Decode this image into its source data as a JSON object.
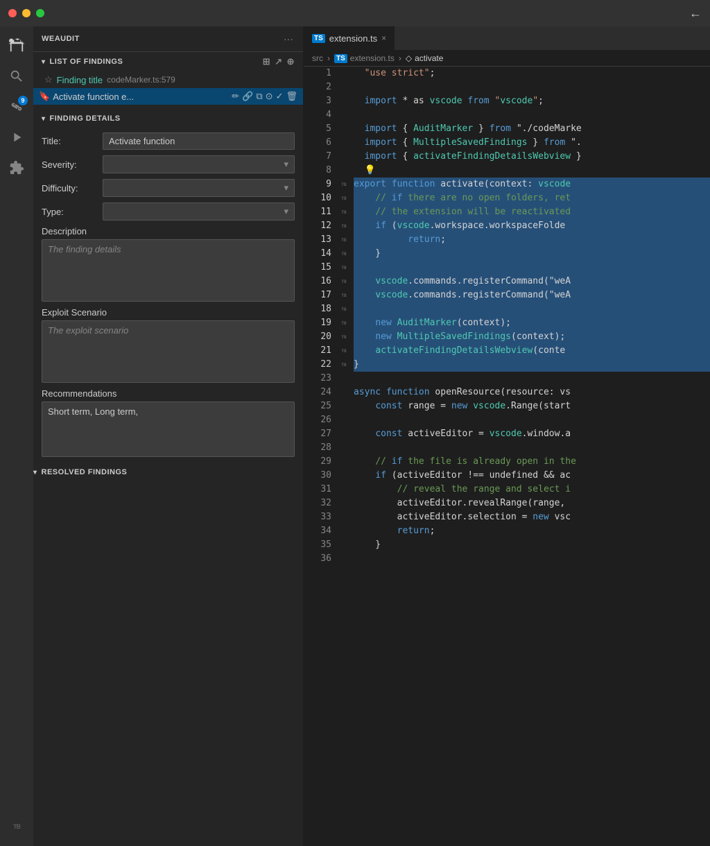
{
  "titleBar": {
    "trafficLights": [
      "red",
      "yellow",
      "green"
    ]
  },
  "activityBar": {
    "icons": [
      {
        "name": "explorer-icon",
        "symbol": "⎘",
        "active": true
      },
      {
        "name": "search-icon",
        "symbol": "🔍",
        "active": false
      },
      {
        "name": "source-control-icon",
        "symbol": "⑂",
        "active": false,
        "badge": "9"
      },
      {
        "name": "run-icon",
        "symbol": "▷",
        "active": false
      },
      {
        "name": "extensions-icon",
        "symbol": "⊞",
        "active": false
      },
      {
        "name": "trailbits-icon",
        "symbol": "TB",
        "active": false
      }
    ]
  },
  "sidebar": {
    "title": "WEAUDIT",
    "menuIcon": "···",
    "sections": {
      "listOfFindings": {
        "label": "LIST OF FINDINGS",
        "icons": [
          "table-icon",
          "share-icon",
          "export-icon"
        ],
        "findingTitle": {
          "icon": "★",
          "label": "Finding title",
          "fileRef": "codeMarker.ts:579"
        },
        "activeFinding": {
          "icon": "🔖",
          "label": "Activate function e...",
          "actions": [
            {
              "name": "edit-icon",
              "symbol": "✏"
            },
            {
              "name": "link-icon",
              "symbol": "🔗"
            },
            {
              "name": "copy-icon",
              "symbol": "⧉"
            },
            {
              "name": "github-icon",
              "symbol": "⊙"
            },
            {
              "name": "check-icon",
              "symbol": "✓"
            },
            {
              "name": "delete-icon",
              "symbol": "🗑"
            }
          ]
        }
      },
      "findingDetails": {
        "label": "FINDING DETAILS",
        "fields": {
          "title": {
            "label": "Title:",
            "value": "Activate function"
          },
          "severity": {
            "label": "Severity:",
            "value": ""
          },
          "difficulty": {
            "label": "Difficulty:",
            "value": ""
          },
          "type": {
            "label": "Type:",
            "value": ""
          }
        },
        "description": {
          "label": "Description",
          "placeholder": "The finding details"
        },
        "exploitScenario": {
          "label": "Exploit Scenario",
          "placeholder": "The exploit scenario"
        },
        "recommendations": {
          "label": "Recommendations",
          "value": "Short term,\nLong term,"
        }
      },
      "resolvedFindings": {
        "label": "RESOLVED FINDINGS"
      }
    }
  },
  "editor": {
    "tab": {
      "tsBadge": "TS",
      "filename": "extension.ts",
      "closeSymbol": "×"
    },
    "breadcrumb": {
      "src": "src",
      "sep1": "›",
      "tsBadge": "TS",
      "file": "extension.ts",
      "sep2": "›",
      "fnIcon": "◇",
      "fn": "activate"
    },
    "lines": [
      {
        "num": "1",
        "content": "  \"use strict\";",
        "highlight": false
      },
      {
        "num": "2",
        "content": "",
        "highlight": false
      },
      {
        "num": "3",
        "content": "  import * as vscode from \"vscode\";",
        "highlight": false
      },
      {
        "num": "4",
        "content": "",
        "highlight": false
      },
      {
        "num": "5",
        "content": "  import { AuditMarker } from \"./codeMarke",
        "highlight": false
      },
      {
        "num": "6",
        "content": "  import { MultipleSavedFindings } from \".",
        "highlight": false
      },
      {
        "num": "7",
        "content": "  import { activateFindingDetailsWebview }",
        "highlight": false
      },
      {
        "num": "8",
        "content": "  💡",
        "highlight": false
      },
      {
        "num": "9",
        "content": "export function activate(context: vscode",
        "highlight": true
      },
      {
        "num": "10",
        "content": "    // if there are no open folders, ret",
        "highlight": true
      },
      {
        "num": "11",
        "content": "    // the extension will be reactivated",
        "highlight": true
      },
      {
        "num": "12",
        "content": "    if (vscode.workspace.workspaceFolde",
        "highlight": true
      },
      {
        "num": "13",
        "content": "          return;",
        "highlight": true
      },
      {
        "num": "14",
        "content": "    }",
        "highlight": true
      },
      {
        "num": "15",
        "content": "",
        "highlight": true
      },
      {
        "num": "16",
        "content": "    vscode.commands.registerCommand(\"weA",
        "highlight": true
      },
      {
        "num": "17",
        "content": "    vscode.commands.registerCommand(\"weA",
        "highlight": true
      },
      {
        "num": "18",
        "content": "",
        "highlight": true
      },
      {
        "num": "19",
        "content": "    new AuditMarker(context);",
        "highlight": true
      },
      {
        "num": "20",
        "content": "    new MultipleSavedFindings(context);",
        "highlight": true
      },
      {
        "num": "21",
        "content": "    activateFindingDetailsWebview(conte",
        "highlight": true
      },
      {
        "num": "22",
        "content": "}",
        "highlight": true
      },
      {
        "num": "23",
        "content": "",
        "highlight": false
      },
      {
        "num": "24",
        "content": "async function openResource(resource: vs",
        "highlight": false
      },
      {
        "num": "25",
        "content": "    const range = new vscode.Range(start",
        "highlight": false
      },
      {
        "num": "26",
        "content": "",
        "highlight": false
      },
      {
        "num": "27",
        "content": "    const activeEditor = vscode.window.a",
        "highlight": false
      },
      {
        "num": "28",
        "content": "",
        "highlight": false
      },
      {
        "num": "29",
        "content": "    // if the file is already open in the",
        "highlight": false
      },
      {
        "num": "30",
        "content": "    if (activeEditor !== undefined && ac",
        "highlight": false
      },
      {
        "num": "31",
        "content": "        // reveal the range and select i",
        "highlight": false
      },
      {
        "num": "32",
        "content": "        activeEditor.revealRange(range,",
        "highlight": false
      },
      {
        "num": "33",
        "content": "        activeEditor.selection = new vsc",
        "highlight": false
      },
      {
        "num": "34",
        "content": "        return;",
        "highlight": false
      },
      {
        "num": "35",
        "content": "    }",
        "highlight": false
      },
      {
        "num": "36",
        "content": "",
        "highlight": false
      }
    ]
  }
}
